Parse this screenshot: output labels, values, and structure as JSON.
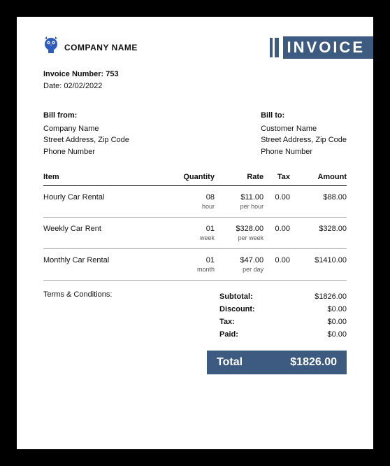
{
  "brand": {
    "company_name": "COMPANY NAME"
  },
  "banner": {
    "word": "INVOICE"
  },
  "meta": {
    "invoice_number_label": "Invoice Number:",
    "invoice_number_value": "753",
    "date_label": "Date:",
    "date_value": "02/02/2022"
  },
  "bill_from": {
    "header": "Bill from:",
    "name": "Company Name",
    "address": "Street Address, Zip Code",
    "phone": "Phone Number"
  },
  "bill_to": {
    "header": "Bill to:",
    "name": "Customer Name",
    "address": "Street Address, Zip Code",
    "phone": "Phone Number"
  },
  "table": {
    "headers": {
      "item": "Item",
      "quantity": "Quantity",
      "rate": "Rate",
      "tax": "Tax",
      "amount": "Amount"
    },
    "rows": [
      {
        "item": "Hourly Car Rental",
        "qty": "08",
        "qty_unit": "hour",
        "rate": "$11.00",
        "rate_unit": "per hour",
        "tax": "0.00",
        "amount": "$88.00"
      },
      {
        "item": "Weekly Car Rent",
        "qty": "01",
        "qty_unit": "week",
        "rate": "$328.00",
        "rate_unit": "per week",
        "tax": "0.00",
        "amount": "$328.00"
      },
      {
        "item": "Monthly Car Rental",
        "qty": "01",
        "qty_unit": "month",
        "rate": "$47.00",
        "rate_unit": "per day",
        "tax": "0.00",
        "amount": "$1410.00"
      }
    ]
  },
  "terms_label": "Terms & Conditions:",
  "summary": {
    "subtotal_label": "Subtotal:",
    "subtotal_value": "$1826.00",
    "discount_label": "Discount:",
    "discount_value": "$0.00",
    "tax_label": "Tax:",
    "tax_value": "$0.00",
    "paid_label": "Paid:",
    "paid_value": "$0.00"
  },
  "total": {
    "label": "Total",
    "value": "$1826.00"
  }
}
